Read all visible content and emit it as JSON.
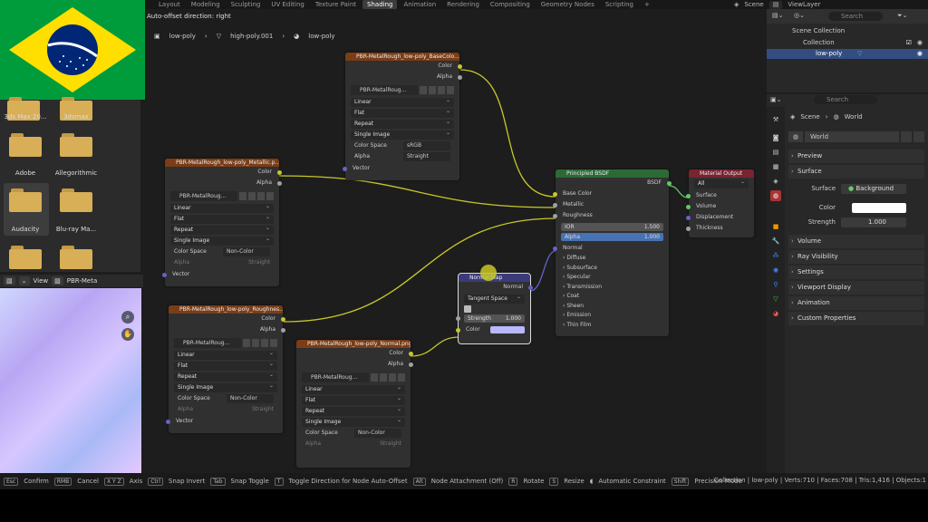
{
  "topbar": {
    "tabs": [
      "Layout",
      "Modeling",
      "Sculpting",
      "UV Editing",
      "Texture Paint",
      "Shading",
      "Animation",
      "Rendering",
      "Compositing",
      "Geometry Nodes",
      "Scripting",
      "+"
    ],
    "active": "Shading",
    "scene": "Scene",
    "view_layer": "ViewLayer"
  },
  "editor": {
    "hint": "Auto-offset direction: right",
    "breadcrumb": [
      "low-poly",
      "high-poly.001",
      "low-poly"
    ]
  },
  "file_browser": {
    "folders": [
      "3ds Max 20...",
      "3dsmax",
      "Adobe",
      "Allegorithmic",
      "Audacity",
      "Blu-ray Ma..."
    ]
  },
  "image_editor": {
    "view": "View",
    "image": "PBR-Meta"
  },
  "nodes": {
    "tex_basecolor": {
      "title": "PBR-MetalRough_low-poly_BaseColo...",
      "out1": "Color",
      "out2": "Alpha",
      "image": "PBR-MetalRoug...",
      "interp": "Linear",
      "proj": "Flat",
      "ext": "Repeat",
      "src": "Single Image",
      "cs_label": "Color Space",
      "cs": "sRGB",
      "alpha_label": "Alpha",
      "alpha": "Straight",
      "vec": "Vector"
    },
    "tex_metallic": {
      "title": "PBR-MetalRough_low-poly_Metallic.p...",
      "out1": "Color",
      "out2": "Alpha",
      "image": "PBR-MetalRoug...",
      "interp": "Linear",
      "proj": "Flat",
      "ext": "Repeat",
      "src": "Single Image",
      "cs_label": "Color Space",
      "cs": "Non-Color",
      "alpha_label": "Alpha",
      "alpha": "Straight",
      "vec": "Vector"
    },
    "tex_rough": {
      "title": "PBR-MetalRough_low-poly_Roughnes...",
      "out1": "Color",
      "out2": "Alpha",
      "image": "PBR-MetalRoug...",
      "interp": "Linear",
      "proj": "Flat",
      "ext": "Repeat",
      "src": "Single Image",
      "cs_label": "Color Space",
      "cs": "Non-Color",
      "alpha_label": "Alpha",
      "alpha": "Straight",
      "vec": "Vector"
    },
    "tex_normal": {
      "title": "PBR-MetalRough_low-poly_Normal.png",
      "out1": "Color",
      "out2": "Alpha",
      "image": "PBR-MetalRoug...",
      "interp": "Linear",
      "proj": "Flat",
      "ext": "Repeat",
      "src": "Single Image",
      "cs_label": "Color Space",
      "cs": "Non-Color",
      "alpha_label": "Alpha",
      "alpha": "Straight",
      "vec": "Vector"
    },
    "bsdf": {
      "title": "Principled BSDF",
      "out": "BSDF",
      "inputs": [
        "Base Color",
        "Metallic",
        "Roughness"
      ],
      "ior_label": "IOR",
      "ior": "1.500",
      "alpha_label": "Alpha",
      "alpha": "1.000",
      "normal": "Normal",
      "panels": [
        "Diffuse",
        "Subsurface",
        "Specular",
        "Transmission",
        "Coat",
        "Sheen",
        "Emission",
        "Thin Film"
      ]
    },
    "output": {
      "title": "Material Output",
      "target": "All",
      "inputs": [
        "Surface",
        "Volume",
        "Displacement",
        "Thickness"
      ]
    },
    "normalmap": {
      "title": "Normal Map",
      "out": "Normal",
      "space": "Tangent Space",
      "strength_label": "Strength",
      "strength": "1.000",
      "color": "Color",
      "color_swatch": "#b8b8ff"
    }
  },
  "outliner": {
    "search": "Search",
    "rows": [
      "Scene Collection",
      "Collection",
      "low-poly"
    ]
  },
  "properties": {
    "search": "Search",
    "scene": "Scene",
    "world_tab": "World",
    "world_name": "World",
    "panels_top": [
      "Preview",
      "Surface"
    ],
    "surface_label": "Surface",
    "surface_val": "Background",
    "color_label": "Color",
    "strength_label": "Strength",
    "strength": "1.000",
    "panels_bottom": [
      "Volume",
      "Ray Visibility",
      "Settings",
      "Viewport Display",
      "Animation",
      "Custom Properties"
    ]
  },
  "status": {
    "items": [
      [
        "Esc",
        "Confirm"
      ],
      [
        "RMB",
        "Cancel"
      ],
      [
        "X Y Z",
        "Axis"
      ],
      [
        "Ctrl",
        "Snap Invert"
      ],
      [
        "Tab",
        "Snap Toggle"
      ],
      [
        "T",
        "Toggle Direction for Node Auto-Offset"
      ],
      [
        "Alt",
        "Node Attachment (Off)"
      ],
      [
        "R",
        "Rotate"
      ],
      [
        "S",
        "Resize"
      ],
      [
        "",
        "Automatic Constraint"
      ],
      [
        "Shift",
        "Precision Mode"
      ]
    ],
    "right": "Collection | low-poly | Verts:710 | Faces:708 | Tris:1,416 | Objects:1"
  },
  "colors": {
    "texture_header": "#7a3d17",
    "bsdf_header": "#2b6a36",
    "output_header": "#7a2430",
    "vector_header": "#3b3b7a",
    "wire": "#c7c729"
  }
}
